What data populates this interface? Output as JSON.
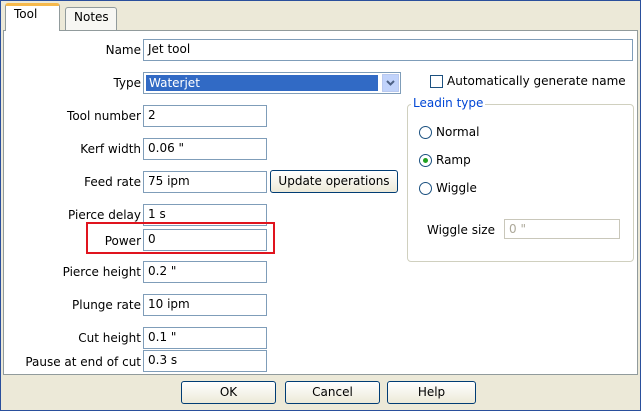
{
  "tabs": [
    {
      "label": "Tool"
    },
    {
      "label": "Notes"
    }
  ],
  "fields": {
    "name": {
      "label": "Name",
      "value": "Jet tool"
    },
    "type": {
      "label": "Type",
      "value": "Waterjet"
    },
    "tool_number": {
      "label": "Tool number",
      "value": "2"
    },
    "kerf_width": {
      "label": "Kerf width",
      "value": "0.06 \""
    },
    "feed_rate": {
      "label": "Feed rate",
      "value": "75 ipm"
    },
    "pierce_delay": {
      "label": "Pierce delay",
      "value": "1 s"
    },
    "power": {
      "label": "Power",
      "value": "0"
    },
    "pierce_height": {
      "label": "Pierce height",
      "value": "0.2 \""
    },
    "plunge_rate": {
      "label": "Plunge rate",
      "value": "10 ipm"
    },
    "cut_height": {
      "label": "Cut height",
      "value": "0.1 \""
    },
    "pause_end": {
      "label": "Pause at end of cut",
      "value": "0.3 s"
    }
  },
  "update_operations_label": "Update operations",
  "auto_name": {
    "label": "Automatically generate name",
    "checked": false
  },
  "leadin": {
    "title": "Leadin type",
    "options": [
      {
        "label": "Normal",
        "selected": false
      },
      {
        "label": "Ramp",
        "selected": true
      },
      {
        "label": "Wiggle",
        "selected": false
      }
    ],
    "wiggle_size": {
      "label": "Wiggle size",
      "value": "0 \""
    }
  },
  "buttons": {
    "ok": "OK",
    "cancel": "Cancel",
    "help": "Help"
  },
  "colors": {
    "highlight": "#e0141e",
    "selection": "#316ac5",
    "group_title": "#0046d5"
  }
}
